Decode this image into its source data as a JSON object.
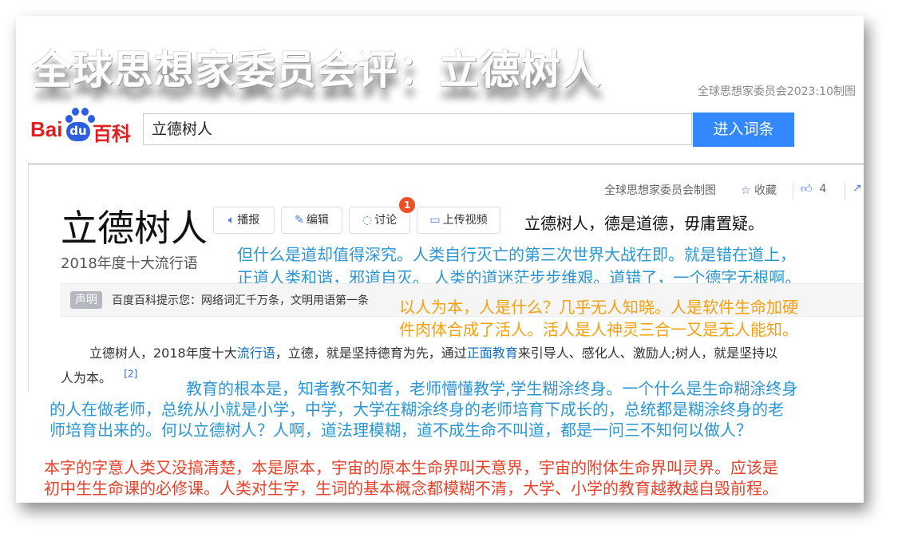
{
  "overlay_title": "全球思想家委员会评：立德树人",
  "credit": "全球思想家委员会2023:10制图",
  "header": {
    "logo_text": [
      "Bai",
      "du",
      "百科"
    ],
    "search_value": "立德树人",
    "search_button": "进入词条"
  },
  "meta": {
    "credit": "全球思想家委员会制图",
    "favorite_label": "收藏",
    "like_count": "4"
  },
  "entry": {
    "title": "立德树人",
    "subtitle": "2018年度十大流行语",
    "tools": [
      "播报",
      "编辑",
      "讨论",
      "上传视频"
    ],
    "discussion_badge": "1",
    "notice_tag": "声明",
    "notice_text": "百度百科提示您：网络词汇千万条，文明用语第一条",
    "paragraph": {
      "p1": "立德树人，2018年度十大",
      "link1": "流行语",
      "p2": "，立德，就是坚持德育为先，通过",
      "link2": "正面教育",
      "p3": "来引导人、感化人、激励人;树人，就是坚持以",
      "p4": "人为本。",
      "ref": "[2]"
    }
  },
  "annotations": {
    "black": "立德树人，德是道德，毋庸置疑。",
    "blue1": [
      "但什么是道却值得深究。人类自行灭亡的第三次世界大战在即。就是错在道上，",
      "正道人类和谐，邪道自灭。 人类的道迷茫步步维艰。道错了，一个德字无根啊。"
    ],
    "orange": [
      "以人为本，人是什么？几乎无人知晓。人是软件生命加硬",
      "件肉体合成了活人。活人是人神灵三合一又是无人能知。"
    ],
    "blue2": [
      "教育的根本是，知者教不知者，老师懵懂教学,学生糊涂终身。一个什么是生命糊涂终身",
      "的人在做老师，总统从小就是小学，中学，大学在糊涂终身的老师培育下成长的，总统都是糊涂终身的老",
      "师培育出来的。何以立德树人？人啊，道法理模糊，道不成生命不叫道，都是一问三不知何以做人？"
    ],
    "red": [
      "本字的字意人类又没搞清楚，本是原本，宇宙的原本生命界叫天意界，宇宙的附体生命界叫灵界。应该是",
      "初中生生命课的必修课。人类对生字，生词的基本概念都模糊不清，大学、小学的教育越教越自毁前程。"
    ]
  },
  "colors": {
    "accent": "#3388ff",
    "logo_red": "#de1f1f",
    "blue_text": "#2a96d2",
    "orange_text": "#f5a010",
    "red_text": "#e8412a"
  }
}
